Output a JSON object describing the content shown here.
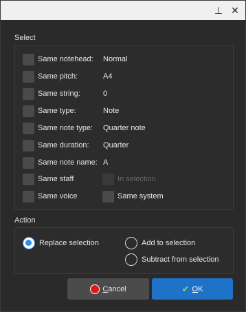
{
  "titlebar": {
    "pin_icon": "pin-icon",
    "close_icon": "close-icon",
    "pin_glyph": "⊥",
    "close_glyph": "✕"
  },
  "select": {
    "title": "Select",
    "rows": [
      {
        "label": "Same notehead:",
        "value": "Normal"
      },
      {
        "label": "Same pitch:",
        "value": "A4"
      },
      {
        "label": "Same string:",
        "value": "0"
      },
      {
        "label": "Same type:",
        "value": "Note"
      },
      {
        "label": "Same note type:",
        "value": "Quarter note"
      },
      {
        "label": "Same duration:",
        "value": "Quarter"
      },
      {
        "label": "Same note name:",
        "value": "A"
      }
    ],
    "same_staff": "Same staff",
    "in_selection": "In selection",
    "same_voice": "Same voice",
    "same_system": "Same system"
  },
  "action": {
    "title": "Action",
    "replace": "Replace selection",
    "add": "Add to selection",
    "subtract": "Subtract from selection"
  },
  "buttons": {
    "cancel_prefix": "",
    "cancel_underline": "C",
    "cancel_rest": "ancel",
    "ok_underline": "O",
    "ok_rest": "K"
  },
  "colors": {
    "accent": "#1e73c8",
    "radio_selected": "#2f8fe8",
    "cancel_icon": "#e01818"
  }
}
